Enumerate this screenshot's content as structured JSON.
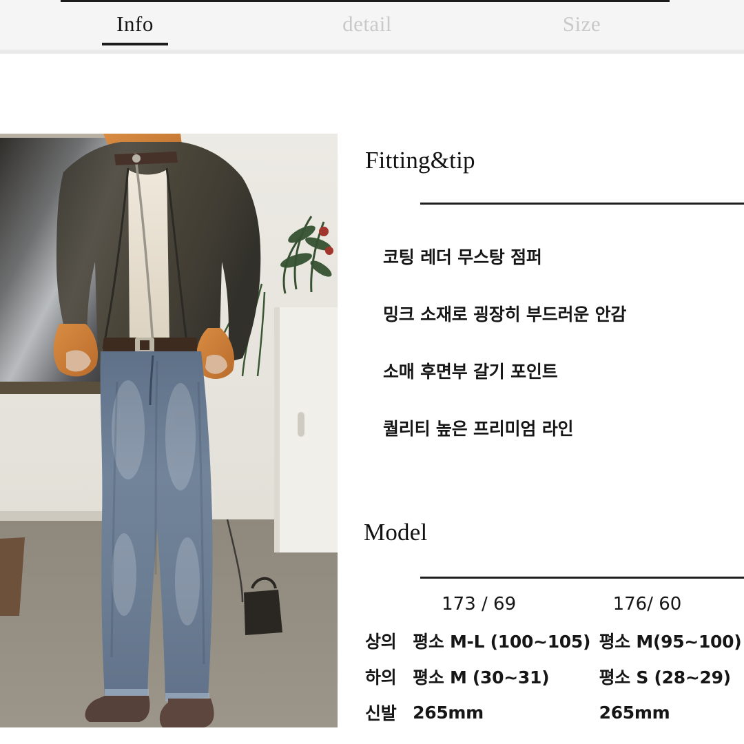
{
  "tabbar": {
    "tabs": [
      {
        "label": "Info",
        "active": true
      },
      {
        "label": "detail",
        "active": false
      },
      {
        "label": "Size",
        "active": false
      }
    ]
  },
  "photo": {
    "alt": "model-wearing-coated-leather-mustang-jacket-and-wide-denim-jeans",
    "colors": {
      "jacket": "#4c4840",
      "fur": "#cf7e3c",
      "knit": "#e8e0d2",
      "denim": "#6d7f94",
      "boots": "#5a4438",
      "floor": "#8b857a",
      "wall": "#e9e7e1"
    }
  },
  "fitting": {
    "title": "Fitting&tip",
    "bullets": [
      "코팅 레더 무스탕 점퍼",
      "밍크 소재로 굉장히 부드러운 안감",
      "소매 후면부 갈기 포인트",
      "퀄리티 높은 프리미엄 라인"
    ]
  },
  "model": {
    "title": "Model",
    "columns": [
      "",
      "173 / 69",
      "176/ 60"
    ],
    "rows": [
      {
        "label": "상의",
        "a": "평소 M-L (100~105)",
        "b": "평소 M(95~100)"
      },
      {
        "label": "하의",
        "a": "평소 M (30~31)",
        "b": "평소 S (28~29)"
      },
      {
        "label": "신발",
        "a": "265mm",
        "b": "265mm"
      }
    ]
  },
  "theme": {
    "header_bg": "#f5f5f5",
    "rule_color": "#1e1e1e",
    "active_tab_color": "#151515",
    "inactive_tab_color": "#c9c9c9",
    "text_color": "#161616"
  }
}
